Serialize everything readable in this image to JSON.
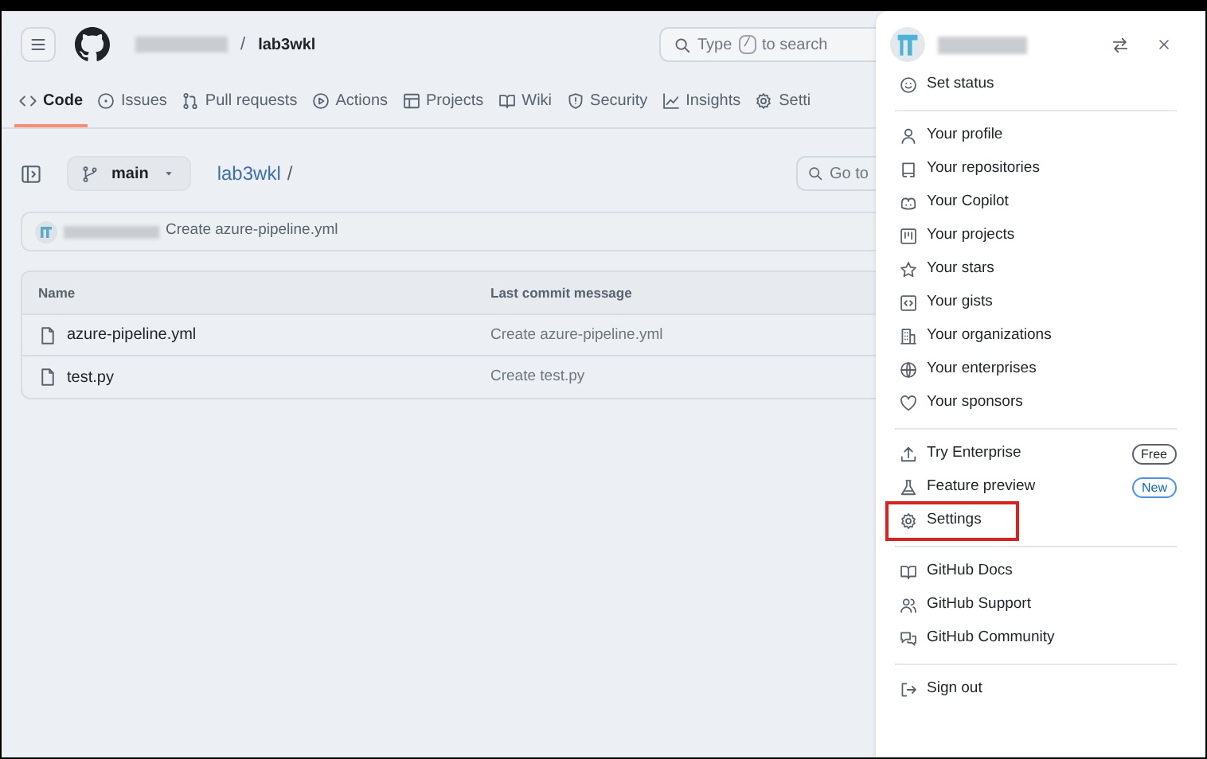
{
  "header": {
    "repo_name": "lab3wkl",
    "search": {
      "placeholder_before": "Type",
      "key": "/",
      "placeholder_after": "to search"
    }
  },
  "tabs": [
    {
      "label": "Code",
      "selected": true
    },
    {
      "label": "Issues",
      "selected": false
    },
    {
      "label": "Pull requests",
      "selected": false
    },
    {
      "label": "Actions",
      "selected": false
    },
    {
      "label": "Projects",
      "selected": false
    },
    {
      "label": "Wiki",
      "selected": false
    },
    {
      "label": "Security",
      "selected": false
    },
    {
      "label": "Insights",
      "selected": false
    },
    {
      "label": "Setti",
      "selected": false
    }
  ],
  "branch": "main",
  "path": "lab3wkl",
  "path_separator": "/",
  "goto_placeholder": "Go to",
  "latest_commit": {
    "message": "Create azure-pipeline.yml"
  },
  "table": {
    "columns": [
      "Name",
      "Last commit message"
    ],
    "rows": [
      {
        "name": "azure-pipeline.yml",
        "message": "Create azure-pipeline.yml"
      },
      {
        "name": "test.py",
        "message": "Create test.py"
      }
    ]
  },
  "user_menu": {
    "groups": [
      [
        {
          "label": "Set status",
          "highlighted": false
        }
      ],
      [
        {
          "label": "Your profile",
          "highlighted": false
        },
        {
          "label": "Your repositories",
          "highlighted": false
        },
        {
          "label": "Your Copilot",
          "highlighted": false
        },
        {
          "label": "Your projects",
          "highlighted": false
        },
        {
          "label": "Your stars",
          "highlighted": false
        },
        {
          "label": "Your gists",
          "highlighted": false
        },
        {
          "label": "Your organizations",
          "highlighted": false
        },
        {
          "label": "Your enterprises",
          "highlighted": false
        },
        {
          "label": "Your sponsors",
          "highlighted": false
        }
      ],
      [
        {
          "label": "Try Enterprise",
          "highlighted": false,
          "badge": {
            "text": "Free",
            "kind": "neutral"
          }
        },
        {
          "label": "Feature preview",
          "highlighted": false,
          "badge": {
            "text": "New",
            "kind": "accent"
          }
        },
        {
          "label": "Settings",
          "highlighted": true
        }
      ],
      [
        {
          "label": "GitHub Docs",
          "highlighted": false
        },
        {
          "label": "GitHub Support",
          "highlighted": false
        },
        {
          "label": "GitHub Community",
          "highlighted": false
        }
      ],
      [
        {
          "label": "Sign out",
          "highlighted": false
        }
      ]
    ]
  }
}
